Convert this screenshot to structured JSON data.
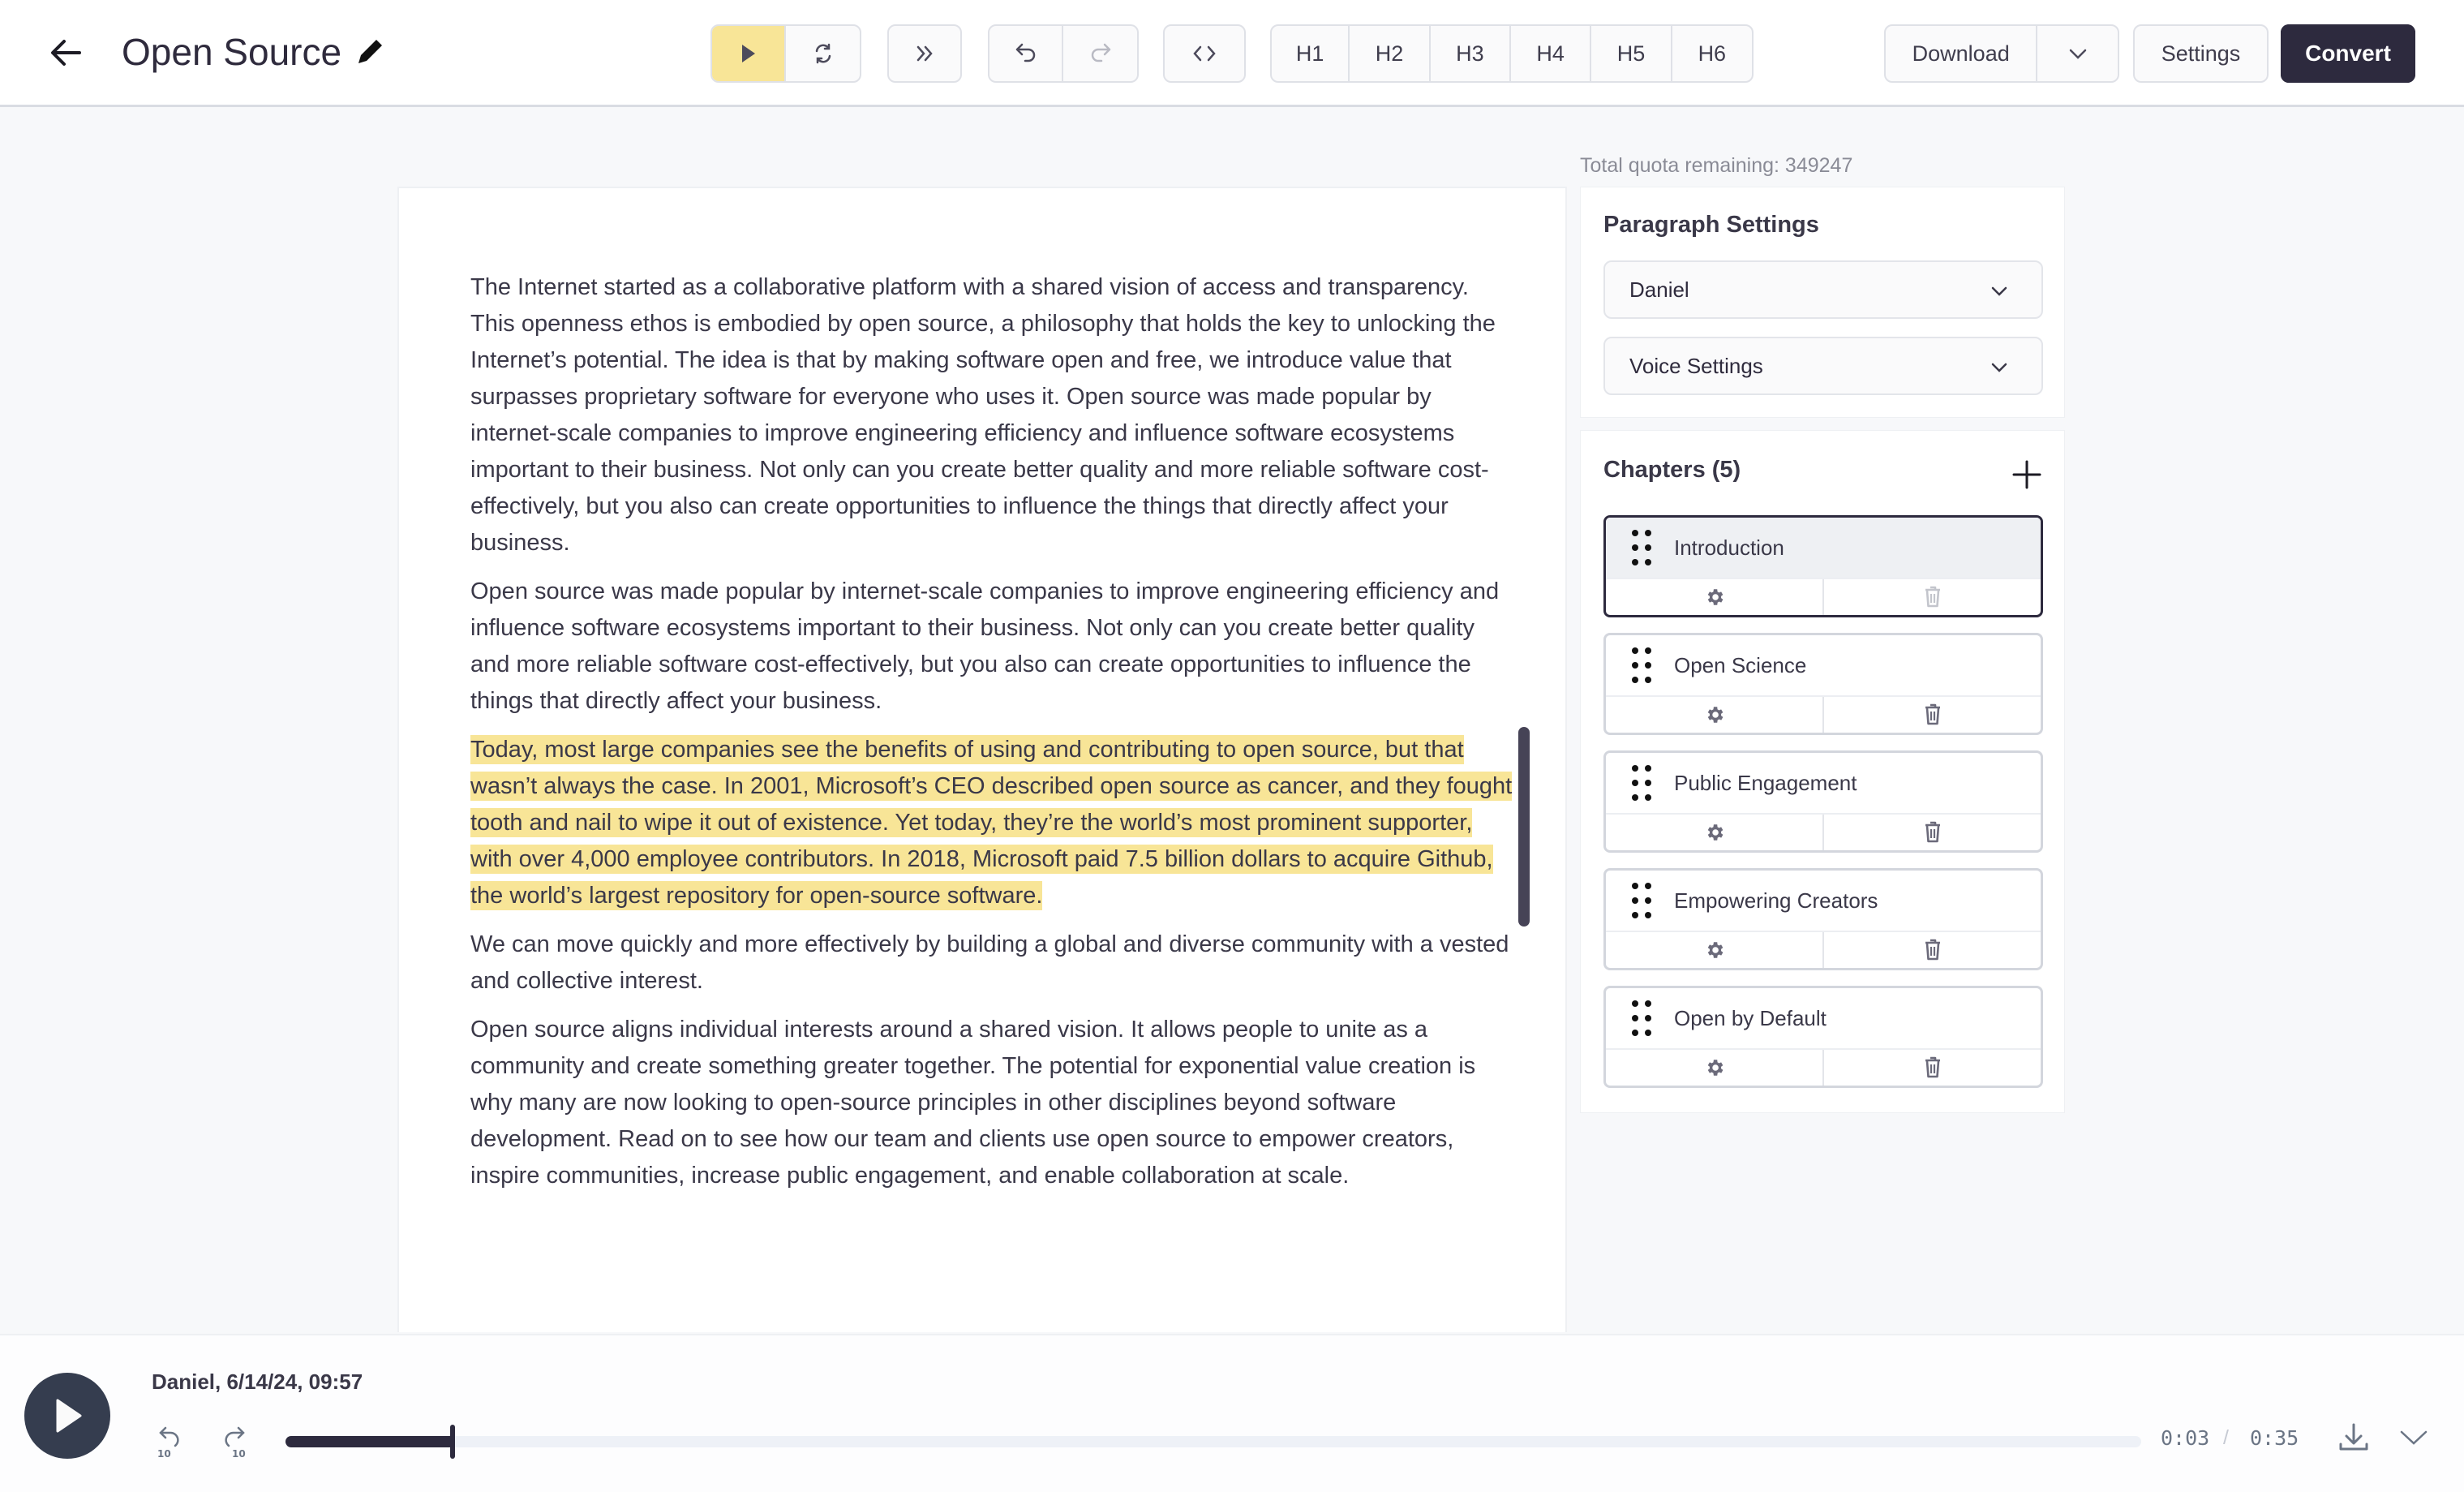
{
  "header": {
    "back_icon": "arrow-left-icon",
    "title": "Open Source",
    "edit_icon": "pencil-icon"
  },
  "toolbar": {
    "play_icon": "play-icon",
    "regenerate_icon": "refresh-icon",
    "skip_icon": "double-chevron-right-icon",
    "undo_icon": "undo-icon",
    "redo_icon": "redo-icon",
    "code_icon": "code-brackets-icon",
    "headings": [
      "H1",
      "H2",
      "H3",
      "H4",
      "H5",
      "H6"
    ],
    "download_label": "Download",
    "download_menu_icon": "chevron-down-icon",
    "settings_label": "Settings",
    "convert_label": "Convert"
  },
  "editor": {
    "paragraphs": [
      {
        "text": " The Internet started as a collaborative platform with a shared vision of access and transparency. This openness ethos is embodied by open source, a philosophy that holds the key to unlocking the Internet’s potential. The idea is that by making software open and free, we introduce value that surpasses proprietary software for everyone who uses it. Open source was made popular by internet-scale companies to improve engineering efficiency and influence software ecosystems important to their business. Not only can you create better quality and more reliable software cost-effectively, but you also can create opportunities to influence the things that directly affect your business.",
        "highlighted": false
      },
      {
        "text": " Open source was made popular by internet-scale companies to improve engineering efficiency and influence software ecosystems important to their business. Not only can you create better quality and more reliable software cost-effectively, but you also can create opportunities to influence the things that directly affect your business.",
        "highlighted": false
      },
      {
        "text": " Today, most large companies see the benefits of using and contributing to open source, but that wasn’t always the case. In 2001, Microsoft’s CEO described open source as cancer, and they fought tooth and nail to wipe it out of existence. Yet today, they’re the world’s most prominent supporter, with over 4,000 employee contributors. In 2018, Microsoft paid 7.5 billion dollars to acquire Github, the world’s largest repository for open-source software.",
        "highlighted": true
      },
      {
        "text": " We can move quickly and more effectively by building a global and diverse community with a vested and collective interest.",
        "highlighted": false
      },
      {
        "text": " Open source aligns individual interests around a shared vision. It allows people to unite as a community and create something greater together. The potential for exponential value creation is why many are now looking to open-source principles in other disciplines beyond software development. Read on to see how our team and clients use open source to empower creators, inspire communities, increase public engagement, and enable collaboration at scale.",
        "highlighted": false
      }
    ],
    "highlight_color": "#f8e597"
  },
  "sidebar": {
    "quota_text": "Total quota remaining: 349247",
    "paragraph_settings": {
      "title": "Paragraph Settings",
      "voice_value": "Daniel",
      "voice_settings_label": "Voice Settings"
    },
    "chapters": {
      "title": "Chapters (5)",
      "add_icon": "plus-icon",
      "items": [
        {
          "label": "Introduction",
          "selected": true,
          "delete_disabled": true
        },
        {
          "label": "Open Science",
          "selected": false,
          "delete_disabled": false
        },
        {
          "label": "Public Engagement",
          "selected": false,
          "delete_disabled": false
        },
        {
          "label": "Empowering Creators",
          "selected": false,
          "delete_disabled": false
        },
        {
          "label": "Open by Default",
          "selected": false,
          "delete_disabled": false
        }
      ]
    }
  },
  "player": {
    "meta": "Daniel, 6/14/24, 09:57",
    "current_time": "0:03",
    "separator": "/",
    "total_time": "0:35",
    "progress_fraction": 0.09,
    "rewind_icon": "rewind-10-icon",
    "forward_icon": "forward-10-icon",
    "download_icon": "download-icon",
    "collapse_icon": "chevron-down-icon"
  },
  "colors": {
    "accent_highlight": "#f8e597",
    "primary_dark": "#2d2a3e",
    "player_button": "#353d4f"
  }
}
